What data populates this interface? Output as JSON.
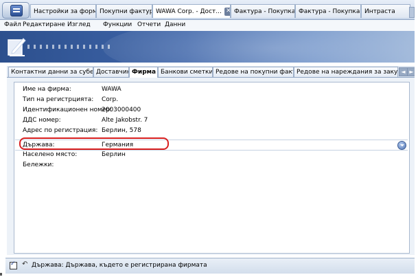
{
  "doc_tabs": [
    {
      "label": "Настройки за форм..."
    },
    {
      "label": "Покупни фактури"
    },
    {
      "label": "WAWA Corp. - Дост..."
    },
    {
      "label": "Фактура - Покупка..."
    },
    {
      "label": "Фактура - Покупка..."
    },
    {
      "label": "Интраста"
    }
  ],
  "close_glyph": "✕",
  "menu": [
    "Файл",
    "Редактиране",
    "Изглед",
    "Функции",
    "Отчети",
    "Данни"
  ],
  "section_tabs": [
    "Контактни данни за субект",
    "Доставчик",
    "Фирма",
    "Банкови сметки",
    "Редове на покупни фактури",
    "Редове на нареждания за закупуване"
  ],
  "active_section_tab": "Фирма",
  "arrows": {
    "left": "◄",
    "right": "►"
  },
  "fields": [
    {
      "label": "Име на фирма:",
      "value": "WAWA"
    },
    {
      "label": "Тип на регистрцията:",
      "value": "Corp."
    },
    {
      "label": "Идентификационен номер:",
      "value": "2003000400"
    },
    {
      "label": "ДДС номер:",
      "value": "Alte Jakobstr. 7"
    },
    {
      "label": "Адрес по регистрация:",
      "value": "Берлин, 578"
    },
    {
      "label": "Държава:",
      "value": "Германия"
    },
    {
      "label": "Населено място:",
      "value": "Берлин"
    },
    {
      "label": "Бележки:",
      "value": ""
    }
  ],
  "status": {
    "undo_glyph": "↶",
    "text": "Държава: Държава, където е регистрирана фирмата"
  },
  "colors": {
    "highlight_oval": "#d81e1e",
    "banner": "#2c4f8d"
  }
}
